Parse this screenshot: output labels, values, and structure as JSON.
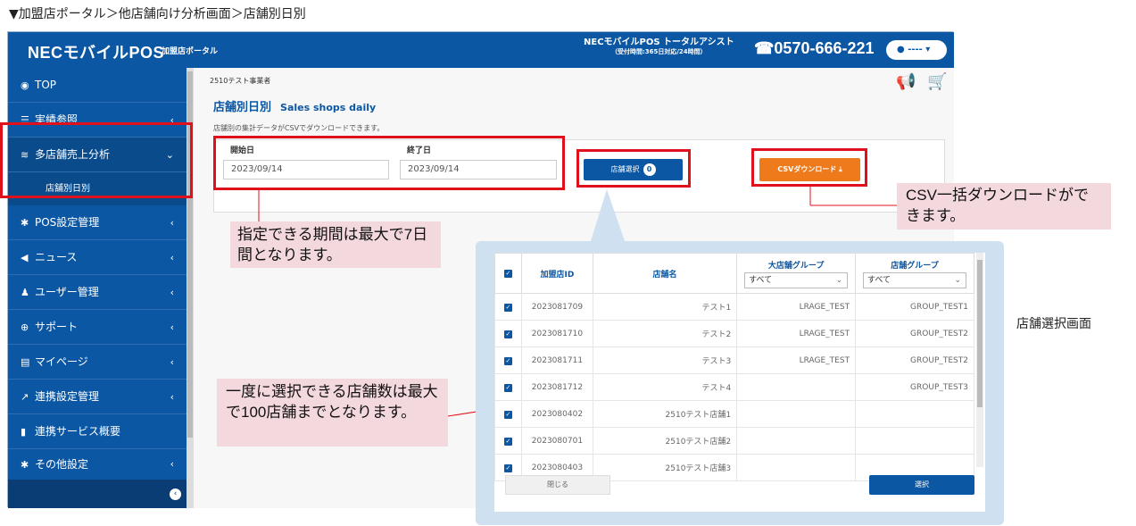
{
  "caption": "▼加盟店ポータル＞他店舗向け分析画面＞店舗別日別",
  "header": {
    "brand": "NECモバイルPOS",
    "portal": "加盟店ポータル",
    "assist_title": "NECモバイルPOS トータルアシスト",
    "assist_hours": "（受付時間:365日対応/24時間）",
    "tel": "0570-666-221",
    "user": "----"
  },
  "sidebar": {
    "items": [
      {
        "icon": "dashboard-icon",
        "label": "TOP"
      },
      {
        "icon": "list-icon",
        "label": "実績参照"
      },
      {
        "icon": "database-icon",
        "label": "多店舗売上分析"
      },
      {
        "icon": "gear-icon",
        "label": "POS設定管理"
      },
      {
        "icon": "megaphone-icon",
        "label": "ニュース"
      },
      {
        "icon": "user-plus-icon",
        "label": "ユーザー管理"
      },
      {
        "icon": "support-icon",
        "label": "サポート"
      },
      {
        "icon": "id-card-icon",
        "label": "マイページ"
      },
      {
        "icon": "external-link-icon",
        "label": "連携設定管理"
      },
      {
        "icon": "book-icon",
        "label": "連携サービス概要"
      },
      {
        "icon": "gear-icon",
        "label": "その他設定"
      }
    ],
    "sub_item": "店舗別日別"
  },
  "main": {
    "breadcrumb": "2510テスト事業者",
    "title": "店舗別日別",
    "title_en": "Sales shops daily",
    "description": "店舗別の集計データがCSVでダウンロードできます。",
    "start_label": "開始日",
    "start_value": "2023/09/14",
    "end_label": "終了日",
    "end_value": "2023/09/14",
    "store_select_label": "店舗選択",
    "store_select_count": "0",
    "csv_button": "CSVダウンロード ⤓"
  },
  "callouts": {
    "csv": "CSV一括ダウンロードができます。",
    "period": "指定できる期間は最大で7日間となります。",
    "max_stores": "一度に選択できる店舗数は最大で100店舗までとなります。"
  },
  "modal": {
    "columns": [
      "加盟店ID",
      "店舗名",
      "大店舗グループ",
      "店舗グループ"
    ],
    "filter_value": "すべて",
    "rows": [
      {
        "id": "2023081709",
        "name": "テスト1",
        "large_group": "LRAGE_TEST",
        "group": "GROUP_TEST1"
      },
      {
        "id": "2023081710",
        "name": "テスト2",
        "large_group": "LRAGE_TEST",
        "group": "GROUP_TEST2"
      },
      {
        "id": "2023081711",
        "name": "テスト3",
        "large_group": "LRAGE_TEST",
        "group": "GROUP_TEST2"
      },
      {
        "id": "2023081712",
        "name": "テスト4",
        "large_group": "",
        "group": "GROUP_TEST3"
      },
      {
        "id": "2023080402",
        "name": "2510テスト店舗1",
        "large_group": "",
        "group": ""
      },
      {
        "id": "2023080701",
        "name": "2510テスト店舗2",
        "large_group": "",
        "group": ""
      },
      {
        "id": "2023080403",
        "name": "2510テスト店舗3",
        "large_group": "",
        "group": ""
      }
    ],
    "close_label": "閉じる",
    "select_label": "選択"
  },
  "side_note": "店舗選択画面",
  "colors": {
    "primary": "#0b57a3",
    "accent": "#ef7a1c",
    "highlight": "#e0101d",
    "callout_bg": "#f3d8dd"
  }
}
